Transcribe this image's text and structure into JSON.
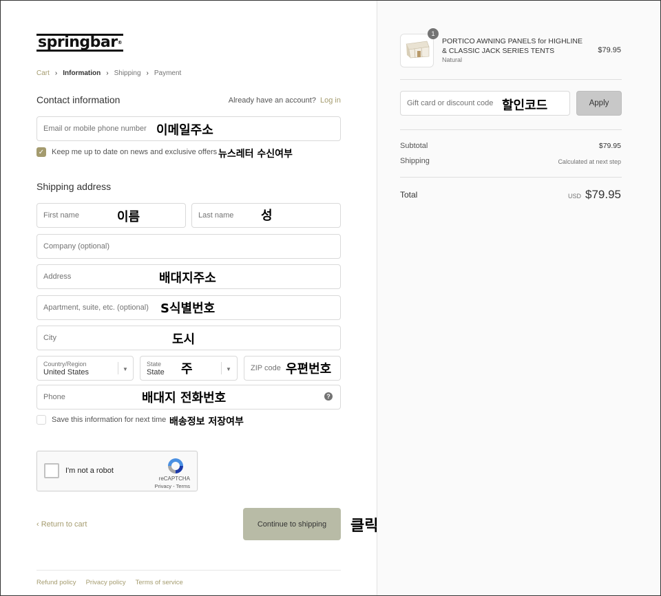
{
  "brand": {
    "logo_text": "springbar",
    "accent": "#a49b6e"
  },
  "breadcrumb": {
    "items": [
      "Cart",
      "Information",
      "Shipping",
      "Payment"
    ],
    "separator": ">"
  },
  "contact": {
    "title": "Contact information",
    "account_prompt": "Already have an account?",
    "login_label": "Log in",
    "email_placeholder": "Email or mobile phone number",
    "email_annotation": "이메일주소",
    "newsletter_label": "Keep me up to date on news and exclusive offers",
    "newsletter_checked": true,
    "newsletter_annotation": "뉴스레터 수신여부"
  },
  "shipping": {
    "title": "Shipping address",
    "first_name_placeholder": "First name",
    "first_name_annotation": "이름",
    "last_name_placeholder": "Last name",
    "last_name_annotation": "성",
    "company_placeholder": "Company (optional)",
    "address_placeholder": "Address",
    "address_annotation": "배대지주소",
    "apartment_placeholder": "Apartment, suite, etc. (optional)",
    "apartment_annotation": "S식별번호",
    "city_placeholder": "City",
    "city_annotation": "도시",
    "country_label": "Country/Region",
    "country_value": "United States",
    "state_label": "State",
    "state_value": "State",
    "state_annotation": "주",
    "zip_placeholder": "ZIP code",
    "zip_annotation": "우편번호",
    "phone_placeholder": "Phone",
    "phone_annotation": "배대지 전화번호",
    "save_label": "Save this information for next time",
    "save_checked": false,
    "save_annotation": "배송정보 저장여부"
  },
  "recaptcha": {
    "label": "I'm not a robot",
    "brand": "reCAPTCHA",
    "terms": "Privacy - Terms"
  },
  "actions": {
    "return_label": "Return to cart",
    "continue_label": "Continue to shipping",
    "continue_annotation": "클릭"
  },
  "footer": {
    "links": [
      "Refund policy",
      "Privacy policy",
      "Terms of service"
    ]
  },
  "summary": {
    "product": {
      "quantity": "1",
      "name": "PORTICO AWNING PANELS for HIGHLINE & CLASSIC JACK SERIES TENTS",
      "variant": "Natural",
      "price": "$79.95"
    },
    "discount_placeholder": "Gift card or discount code",
    "discount_annotation": "할인코드",
    "apply_label": "Apply",
    "subtotal_label": "Subtotal",
    "subtotal_value": "$79.95",
    "shipping_label": "Shipping",
    "shipping_value": "Calculated at next step",
    "total_label": "Total",
    "total_currency": "USD",
    "total_value": "$79.95"
  }
}
